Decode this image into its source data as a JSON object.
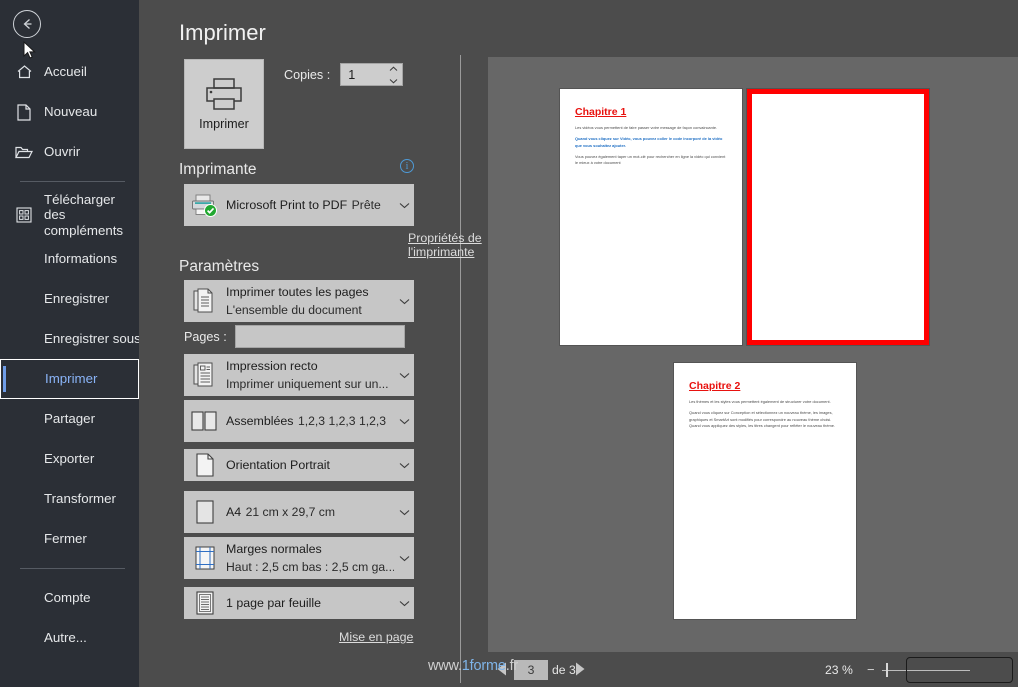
{
  "nav": {
    "back_button": "back-arrow",
    "items": [
      {
        "label": "Accueil",
        "icon": "home-icon",
        "has_icon": true
      },
      {
        "label": "Nouveau",
        "icon": "new-document-icon",
        "has_icon": true
      },
      {
        "label": "Ouvrir",
        "icon": "open-folder-icon",
        "has_icon": true
      },
      {
        "label": "Télécharger des compléments",
        "icon": "addins-grid-icon",
        "has_icon": true,
        "two_line": true
      },
      {
        "label": "Informations",
        "has_icon": false
      },
      {
        "label": "Enregistrer",
        "has_icon": false
      },
      {
        "label": "Enregistrer sous",
        "has_icon": false
      },
      {
        "label": "Imprimer",
        "has_icon": false,
        "selected": true
      },
      {
        "label": "Partager",
        "has_icon": false
      },
      {
        "label": "Exporter",
        "has_icon": false
      },
      {
        "label": "Transformer",
        "has_icon": false
      },
      {
        "label": "Fermer",
        "has_icon": false
      },
      {
        "label": "Compte",
        "has_icon": false
      },
      {
        "label": "Autre...",
        "has_icon": false
      }
    ]
  },
  "settings": {
    "page_title": "Imprimer",
    "print_button_label": "Imprimer",
    "print_button_icon": "printer-icon",
    "copies_label": "Copies :",
    "copies_value": "1",
    "printer_section_title": "Imprimante",
    "printer_info_icon": "info-icon",
    "printer_name": "Microsoft Print to PDF",
    "printer_status": "Prête",
    "printer_icon": "printer-ready-icon",
    "printer_properties_link": "Propriétés de l'imprimante",
    "parameters_section_title": "Paramètres",
    "rows": [
      {
        "icon": "print-all-pages-icon",
        "line1": "Imprimer toutes les pages",
        "line2": "L'ensemble du document"
      },
      {
        "icon": "one-sided-icon",
        "line1": "Impression recto",
        "line2": "Imprimer uniquement sur un..."
      },
      {
        "icon": "collate-icon",
        "line1": "Assemblées",
        "line2": "1,2,3    1,2,3    1,2,3"
      },
      {
        "icon": "orientation-portrait-icon",
        "line1": "Orientation Portrait",
        "line2": ""
      },
      {
        "icon": "paper-size-icon",
        "line1": "A4",
        "line2": "21 cm x 29,7 cm"
      },
      {
        "icon": "margins-icon",
        "line1": "Marges normales",
        "line2": "Haut : 2,5 cm bas : 2,5 cm ga..."
      },
      {
        "icon": "pages-per-sheet-icon",
        "line1": "1 page par feuille",
        "line2": ""
      }
    ],
    "pages_label": "Pages :",
    "pages_value": "",
    "pages_placeholder": "",
    "pages_info_icon": "info-icon",
    "page_setup_link": "Mise en page"
  },
  "preview": {
    "pages": [
      {
        "title": "Chapitre 1",
        "paragraphs": [
          {
            "text": "Les vidéos vous permettent de faire passer votre message de façon convaincante.",
            "style": "normal"
          },
          {
            "text": "Quand vous cliquez sur Vidéo, vous pouvez coller le code incorporé de la vidéo que vous souhaitez ajouter.",
            "style": "blue"
          },
          {
            "text": "Vous pouvez également taper un mot-clé pour rechercher en ligne la vidéo qui convient le mieux à votre document",
            "style": "normal"
          }
        ]
      },
      {
        "title": "Chapitre 2",
        "paragraphs": [
          {
            "text": "Les thèmes et les styles vous permettent également de structurer votre document.",
            "style": "normal"
          },
          {
            "text": "Quand vous cliquez sur Conception et sélectionnez un nouveau thème, les images, graphiques et SmartArt sont modifiés pour correspondre au nouveau thème choisi. Quand vous appliquez des styles, les titres changent pour refléter le nouveau thème.",
            "style": "normal"
          }
        ]
      },
      {
        "title": "",
        "blank": true,
        "highlight_color": "#ff0000",
        "paragraphs": []
      }
    ]
  },
  "statusbar": {
    "prev_icon": "previous-page-arrow",
    "next_icon": "next-page-arrow",
    "current_page": "3",
    "page_total_label": "de 3",
    "zoom_level": "23 %",
    "zoom_out_label": "−",
    "zoom_in_label": "+",
    "fit_page_icon": "zoom-to-page-button"
  },
  "watermark": {
    "prefix": "www.",
    "highlight": "1forme",
    "suffix": ".fr",
    "full": "www.1forme.fr"
  },
  "colors": {
    "nav_bg": "#2b2f36",
    "settings_bg": "#4c4c4c",
    "preview_bg": "#676767",
    "accent_blue": "#8ab4f8",
    "info_blue": "#4e9ad6",
    "chapter_red": "#e8120f",
    "highlight_red": "#ff0000",
    "combo_bg": "#c6c6c6"
  }
}
